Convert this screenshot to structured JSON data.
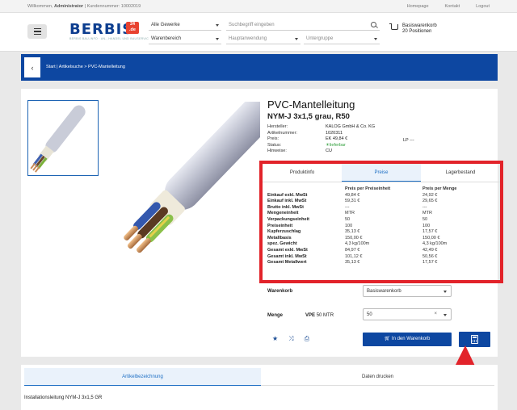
{
  "topbar": {
    "welcome_prefix": "Willkommen,",
    "user": "Administrator",
    "customer": "| Kundennummer: 10002019",
    "links": [
      "Homepage",
      "Kontakt",
      "Logout"
    ]
  },
  "header": {
    "logo_text": "BERBIS",
    "logo_badge": "24\n.de",
    "logo_tagline": "BERBIS BAU-INFO · AN-, HANDEL UND BAUSERVICES",
    "filters": {
      "gewerke": "Alle Gewerke",
      "warenbereich": "Warenbereich",
      "hauptanwendung": "Hauptanwendung",
      "untergruppe": "Untergruppe"
    },
    "search_placeholder": "Suchbegriff eingeben",
    "cart_title": "Basiswarenkorb",
    "cart_count": "20 Positionen"
  },
  "breadcrumb": "Start | Artikelsuche > PVC-Mantelleitung",
  "product": {
    "title": "PVC-Mantelleitung",
    "subtitle": "NYM-J 3x1,5 grau, R50",
    "meta": [
      {
        "label": "Hersteller:",
        "value": "KALOG GmbH & Co. KG"
      },
      {
        "label": "Artikelnummer:",
        "value": "1020311"
      },
      {
        "label": "Preis:",
        "value": "EK 49,84 €"
      },
      {
        "label": "Status:",
        "value": "lieferbar"
      },
      {
        "label": "Hinweise:",
        "value": "CU"
      }
    ],
    "lp": "LP ---"
  },
  "tabs": [
    "Produktinfo",
    "Preise",
    "Lagerbestand"
  ],
  "price_table": {
    "headers": [
      "",
      "Preis per Preiseinheit",
      "Preis per Menge"
    ],
    "rows": [
      [
        "Einkauf exkl. MwSt",
        "49,84 €",
        "24,92 €"
      ],
      [
        "Einkauf inkl. MwSt",
        "59,31 €",
        "29,65 €"
      ],
      [
        "Brutto inkl. MwSt",
        "---",
        "---"
      ],
      [
        "Mengeneinheit",
        "MTR",
        "MTR"
      ],
      [
        "Verpackungseinheit",
        "50",
        "50"
      ],
      [
        "Preiseinheit",
        "100",
        "100"
      ],
      [
        "Kupferzuschlag",
        "35,13 €",
        "17,57 €"
      ],
      [
        "Metallbasis",
        "150,00 €",
        "150,00 €"
      ],
      [
        "spez. Gewicht",
        "4,3 kg/100m",
        "4,3 kg/100m"
      ],
      [
        "Gesamt exkl. MwSt",
        "84,97 €",
        "42,49 €"
      ],
      [
        "Gesamt inkl. MwSt",
        "101,12 €",
        "50,56 €"
      ],
      [
        "Gesamt Metallwert",
        "35,13 €",
        "17,57 €"
      ]
    ]
  },
  "order": {
    "warenkorb_label": "Warenkorb",
    "warenkorb_value": "Basiswarenkorb",
    "menge_label": "Menge",
    "vpe_label": "VPE",
    "vpe_value": "50 MTR",
    "menge_value": "50",
    "clear_symbol": "×",
    "add_to_cart": "In den Warenkorb"
  },
  "bottom_tabs": [
    "Artikelbezeichnung",
    "Daten drucken"
  ],
  "description": "Installationsleitung NYM-J 3x1,5 GR",
  "colors": {
    "brand_blue": "#0d47a1",
    "highlight_red": "#e2232a",
    "status_green": "#2f9e3a"
  }
}
